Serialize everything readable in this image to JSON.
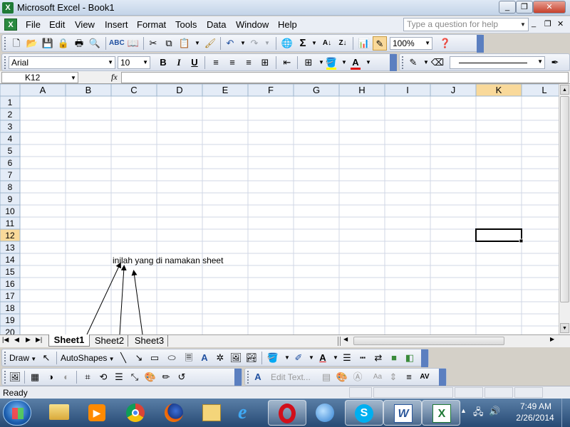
{
  "window": {
    "title": "Microsoft Excel - Book1",
    "min": "_",
    "restore": "❐",
    "close": "✕",
    "doc_min": "_",
    "doc_restore": "❐",
    "doc_close": "✕"
  },
  "menu": {
    "items": [
      "File",
      "Edit",
      "View",
      "Insert",
      "Format",
      "Tools",
      "Data",
      "Window",
      "Help"
    ],
    "help_placeholder": "Type a question for help"
  },
  "standard_toolbar": {
    "zoom": "100%"
  },
  "format_toolbar": {
    "font": "Arial",
    "size": "10",
    "bold": "B",
    "italic": "I",
    "underline": "U",
    "font_color_letter": "A"
  },
  "formula_bar": {
    "name_box": "K12",
    "fx": "fx",
    "content": ""
  },
  "grid": {
    "columns": [
      "A",
      "B",
      "C",
      "D",
      "E",
      "F",
      "G",
      "H",
      "I",
      "J",
      "K",
      "L"
    ],
    "rows": [
      "1",
      "2",
      "3",
      "4",
      "5",
      "6",
      "7",
      "8",
      "9",
      "10",
      "11",
      "12",
      "13",
      "14",
      "15",
      "16",
      "17",
      "18",
      "19",
      "20"
    ],
    "active_column": "K",
    "active_row": "12",
    "annotation": "inilah yang di namakan sheet"
  },
  "sheets": {
    "tabs": [
      "Sheet1",
      "Sheet2",
      "Sheet3"
    ],
    "active": "Sheet1"
  },
  "drawing_toolbar": {
    "draw": "Draw",
    "autoshapes": "AutoShapes"
  },
  "picture_toolbar": {
    "edit_text": "Edit Text..."
  },
  "status": {
    "text": "Ready"
  },
  "taskbar": {
    "time": "7:49 AM",
    "date": "2/26/2014",
    "apps": [
      "explorer",
      "media-player",
      "chrome",
      "firefox",
      "paint",
      "internet-explorer",
      "opera",
      "thunderbird",
      "skype",
      "word",
      "excel"
    ]
  },
  "colors": {
    "grid_line": "#d0d7e5",
    "header_bg": "#e4ecf7",
    "active_header": "#f9d99a",
    "taskbar_top": "#5a7fa7",
    "fill_yellow": "#ffff00",
    "font_red": "#e01010"
  }
}
